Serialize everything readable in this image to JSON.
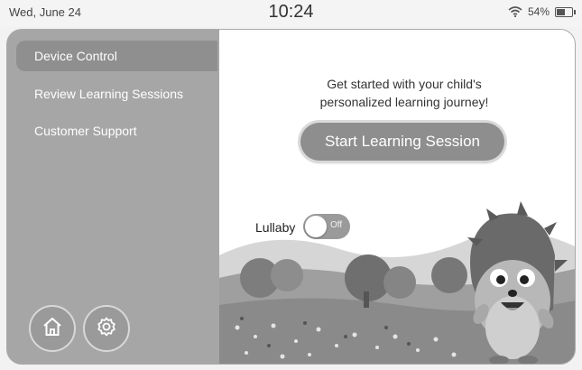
{
  "status_bar": {
    "date": "Wed, June 24",
    "time": "10:24",
    "battery_percent": "54%",
    "battery_level": 0.54
  },
  "sidebar": {
    "items": [
      {
        "label": "Device Control",
        "active": true
      },
      {
        "label": "Review Learning Sessions",
        "active": false
      },
      {
        "label": "Customer Support",
        "active": false
      }
    ],
    "home_icon": "home-icon",
    "settings_icon": "gear-icon"
  },
  "main": {
    "prompt_line1": "Get started with your child's",
    "prompt_line2": "personalized learning journey!",
    "start_button": "Start Learning Session",
    "lullaby_label": "Lullaby",
    "lullaby_toggle_state": "Off"
  },
  "colors": {
    "sidebar_bg": "#a6a6a6",
    "sidebar_active": "#8f8f8f",
    "button_bg": "#8e8e8e"
  }
}
